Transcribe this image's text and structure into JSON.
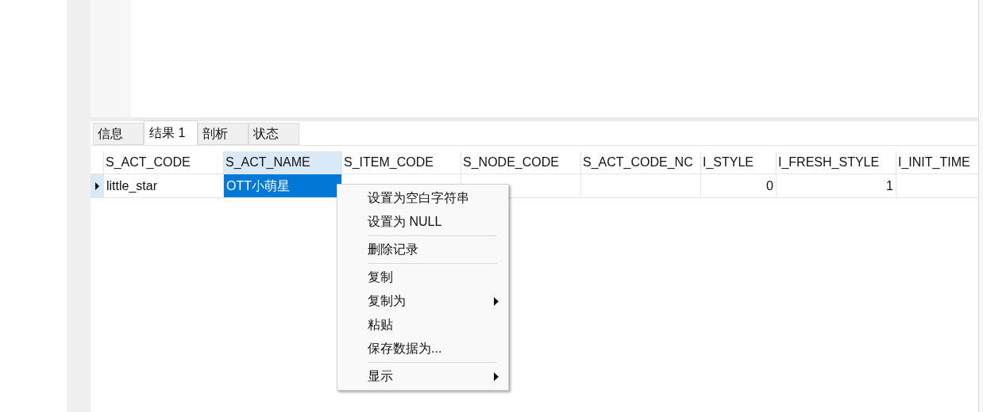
{
  "result_tabs": [
    {
      "label": "信息",
      "selected": false
    },
    {
      "label": "结果 1",
      "selected": true
    },
    {
      "label": "剖析",
      "selected": false
    },
    {
      "label": "状态",
      "selected": false
    }
  ],
  "table": {
    "columns": [
      {
        "label": "S_ACT_CODE",
        "selected": false
      },
      {
        "label": "S_ACT_NAME",
        "selected": true
      },
      {
        "label": "S_ITEM_CODE",
        "selected": false
      },
      {
        "label": "S_NODE_CODE",
        "selected": false
      },
      {
        "label": "S_ACT_CODE_NC",
        "selected": false
      },
      {
        "label": "I_STYLE",
        "selected": false
      },
      {
        "label": "I_FRESH_STYLE",
        "selected": false
      },
      {
        "label": "I_INIT_TIME",
        "selected": false
      }
    ],
    "rows": [
      {
        "selected": true,
        "cells": [
          {
            "text": "little_star",
            "kind": "text",
            "selected": false
          },
          {
            "text": "OTT小萌星",
            "kind": "text",
            "selected": true
          },
          {
            "kind": "text",
            "selected": false
          },
          {
            "kind": "text",
            "selected": false
          },
          {
            "kind": "text",
            "selected": false
          },
          {
            "text": "0",
            "kind": "number",
            "selected": false
          },
          {
            "text": "1",
            "kind": "number",
            "selected": false
          },
          {
            "kind": "text",
            "selected": false
          }
        ]
      }
    ]
  },
  "context_menu": {
    "items": [
      {
        "kind": "item",
        "label": "设置为空白字符串",
        "has_submenu": false
      },
      {
        "kind": "item",
        "label": "设置为 NULL",
        "has_submenu": false
      },
      {
        "kind": "separator"
      },
      {
        "kind": "item",
        "label": "删除记录",
        "has_submenu": false
      },
      {
        "kind": "separator"
      },
      {
        "kind": "item",
        "label": "复制",
        "has_submenu": false
      },
      {
        "kind": "item",
        "label": "复制为",
        "has_submenu": true
      },
      {
        "kind": "item",
        "label": "粘贴",
        "has_submenu": false
      },
      {
        "kind": "item",
        "label": "保存数据为...",
        "has_submenu": false
      },
      {
        "kind": "separator"
      },
      {
        "kind": "item",
        "label": "显示",
        "has_submenu": true
      }
    ]
  }
}
